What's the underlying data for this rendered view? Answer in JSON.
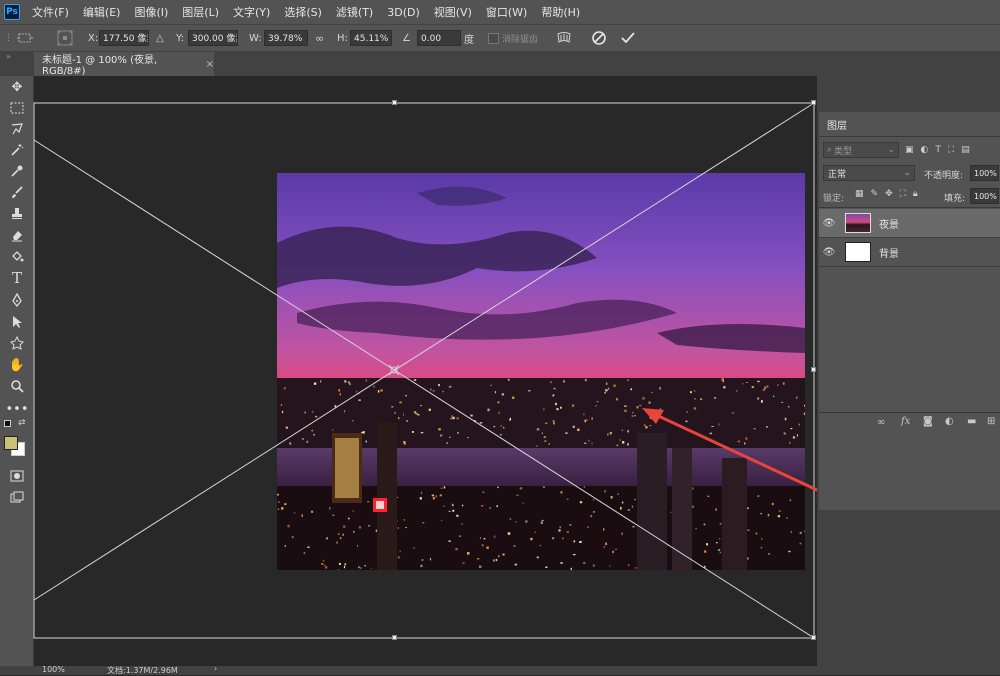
{
  "app": {
    "logo_text": "Ps",
    "accent": "#31a8ff"
  },
  "menu": [
    "文件(F)",
    "编辑(E)",
    "图像(I)",
    "图层(L)",
    "文字(Y)",
    "选择(S)",
    "滤镜(T)",
    "3D(D)",
    "视图(V)",
    "窗口(W)",
    "帮助(H)"
  ],
  "options": {
    "x_label": "X:",
    "x_value": "177.50 像素",
    "y_label": "Y:",
    "y_value": "300.00 像素",
    "w_label": "W:",
    "w_value": "39.78%",
    "h_label": "H:",
    "h_value": "45.11%",
    "angle_value": "0.00",
    "angle_unit": "度",
    "antialias_label": "消除锯齿"
  },
  "document_tab": {
    "title": "未标题-1 @ 100% (夜景, RGB/8#)",
    "close": "×"
  },
  "tools": [
    "move-icon",
    "marquee-icon",
    "lasso-icon",
    "magic-wand-icon",
    "eyedropper-icon",
    "brush-icon",
    "stamp-icon",
    "eraser-icon",
    "bucket-icon",
    "type-icon",
    "pen-icon",
    "path-select-icon",
    "shape-icon",
    "hand-icon",
    "zoom-icon",
    "more-icon"
  ],
  "colors": {
    "foreground": "#c9c276",
    "background": "#ffffff",
    "arrow": "#e8453c"
  },
  "layers_panel": {
    "tab_label": "图层",
    "filter_label": "类型",
    "blend_mode": "正常",
    "opacity_label": "不透明度:",
    "opacity_value": "100%",
    "lock_label": "锁定:",
    "fill_label": "填充:",
    "fill_value": "100%",
    "layers": [
      {
        "name": "夜景",
        "selected": true
      },
      {
        "name": "背景",
        "selected": false
      }
    ]
  },
  "status": {
    "zoom": "100%",
    "doc_info": "文档:1.37M/2.96M"
  }
}
